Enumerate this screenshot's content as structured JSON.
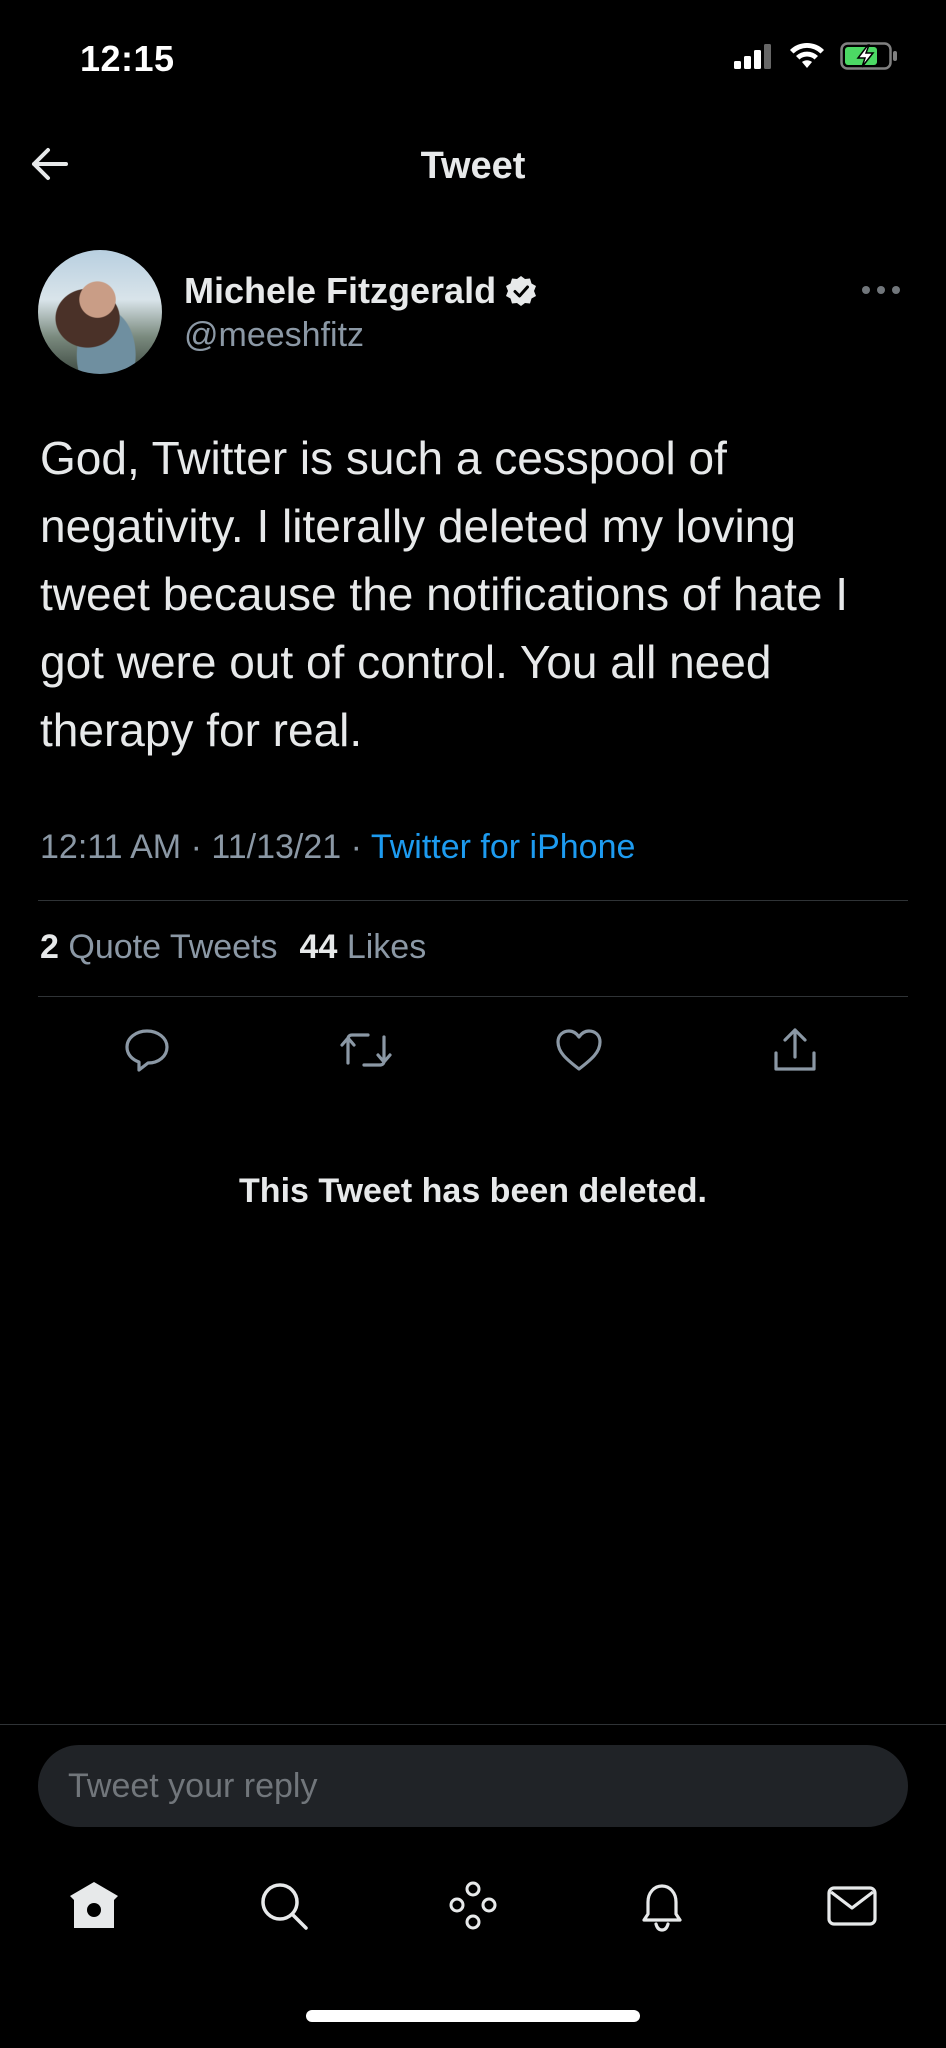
{
  "status_bar": {
    "time": "12:15",
    "icons": [
      "signal-icon",
      "wifi-icon",
      "battery-charging-icon"
    ]
  },
  "header": {
    "title": "Tweet",
    "back_icon": "arrow-left-icon"
  },
  "author": {
    "name": "Michele Fitzgerald",
    "handle": "@meeshfitz",
    "verified": true
  },
  "tweet": {
    "text": "God, Twitter is such a cesspool of negativity. I literally deleted my loving tweet because the notifications of hate I got were out of control. You all need therapy for real.",
    "time": "12:11 AM",
    "date": "11/13/21",
    "source": "Twitter for iPhone",
    "separator": "·"
  },
  "stats": {
    "quote_tweets_count": "2",
    "quote_tweets_label": "Quote Tweets",
    "likes_count": "44",
    "likes_label": "Likes"
  },
  "actions": [
    "reply-icon",
    "retweet-icon",
    "like-icon",
    "share-icon"
  ],
  "deleted_notice": "This Tweet has been deleted.",
  "reply": {
    "placeholder": "Tweet your reply"
  },
  "tabbar": [
    "home-icon",
    "search-icon",
    "spaces-icon",
    "notifications-icon",
    "messages-icon"
  ],
  "colors": {
    "background": "#000000",
    "text_primary": "#e7e9ea",
    "text_secondary": "#8b98a5",
    "accent": "#1d9bf0",
    "divider": "#2f3336",
    "battery_green": "#4cd964"
  }
}
